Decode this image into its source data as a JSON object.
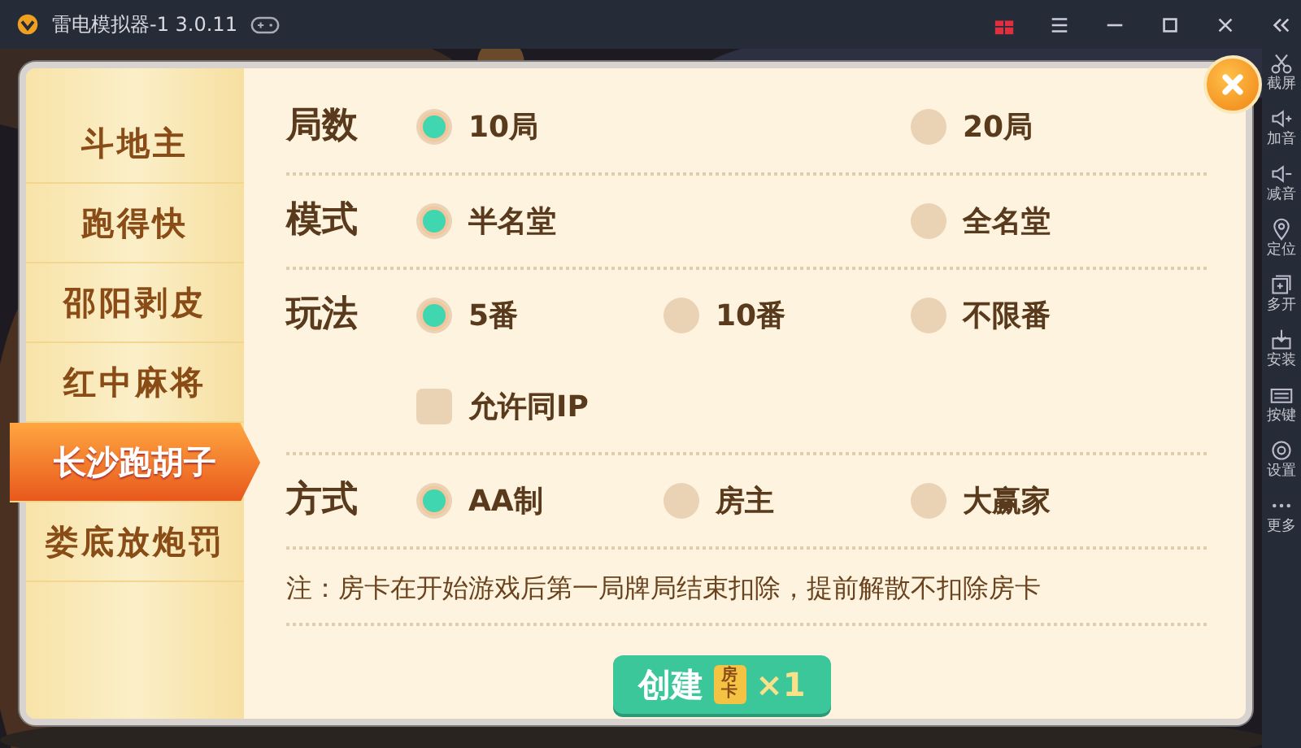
{
  "window": {
    "title": "雷电模拟器-1 3.0.11"
  },
  "toolbar": {
    "items": [
      {
        "label": "截屏",
        "kind": "scissors"
      },
      {
        "label": "加音",
        "kind": "volup"
      },
      {
        "label": "减音",
        "kind": "voldown"
      },
      {
        "label": "定位",
        "kind": "pin"
      },
      {
        "label": "多开",
        "kind": "multi"
      },
      {
        "label": "安装",
        "kind": "install"
      },
      {
        "label": "按键",
        "kind": "keyboard"
      },
      {
        "label": "设置",
        "kind": "gear"
      },
      {
        "label": "更多",
        "kind": "more"
      }
    ]
  },
  "dialog": {
    "tabs": [
      {
        "label": "斗地主",
        "selected": false
      },
      {
        "label": "跑得快",
        "selected": false
      },
      {
        "label": "邵阳剥皮",
        "selected": false
      },
      {
        "label": "红中麻将",
        "selected": false
      },
      {
        "label": "长沙跑胡子",
        "selected": true
      },
      {
        "label": "娄底放炮罚",
        "selected": false
      }
    ],
    "sections": [
      {
        "label": "局数",
        "rows": [
          {
            "kind": "radio",
            "options": [
              {
                "label": "10局",
                "selected": true
              },
              {
                "label": "20局",
                "selected": false
              }
            ]
          }
        ]
      },
      {
        "label": "模式",
        "rows": [
          {
            "kind": "radio",
            "options": [
              {
                "label": "半名堂",
                "selected": true
              },
              {
                "label": "全名堂",
                "selected": false
              }
            ]
          }
        ]
      },
      {
        "label": "玩法",
        "rows": [
          {
            "kind": "radio",
            "options": [
              {
                "label": "5番",
                "selected": true
              },
              {
                "label": "10番",
                "selected": false
              },
              {
                "label": "不限番",
                "selected": false
              }
            ]
          },
          {
            "kind": "checkbox",
            "options": [
              {
                "label": "允许同IP",
                "checked": false
              }
            ]
          }
        ]
      },
      {
        "label": "方式",
        "rows": [
          {
            "kind": "radio",
            "options": [
              {
                "label": "AA制",
                "selected": true
              },
              {
                "label": "房主",
                "selected": false
              },
              {
                "label": "大赢家",
                "selected": false
              }
            ]
          }
        ]
      }
    ],
    "note": "注：房卡在开始游戏后第一局牌局结束扣除，提前解散不扣除房卡",
    "create_button": {
      "label": "创建",
      "card": "房卡",
      "count": "×1"
    }
  }
}
